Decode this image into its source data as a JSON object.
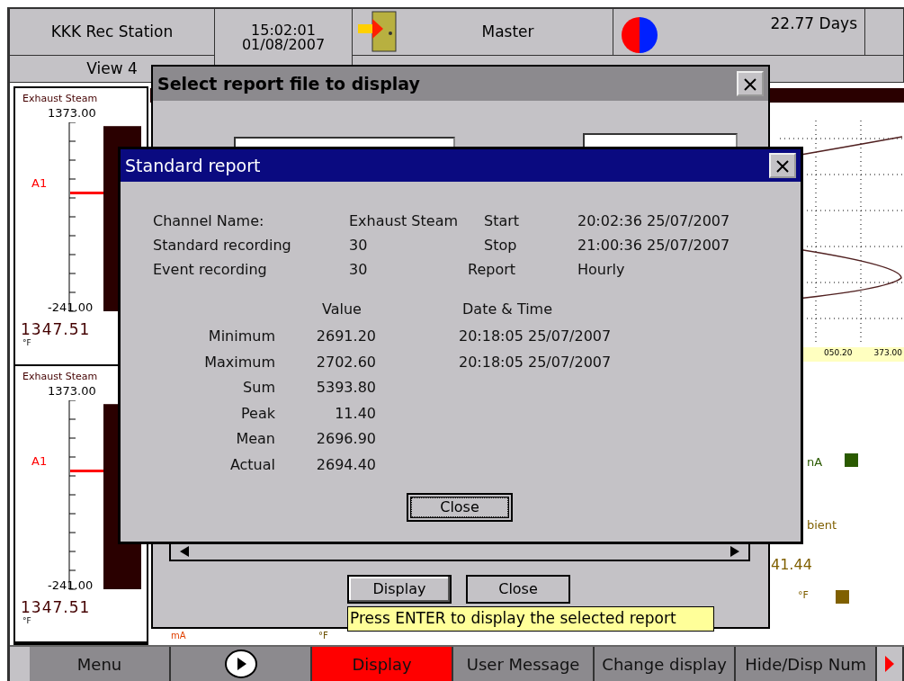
{
  "header": {
    "station": "KKK Rec Station",
    "view": "View 4",
    "time": "15:02:01",
    "date": "01/08/2007",
    "user": "Master",
    "uptime": "22.77 Days"
  },
  "strips": [
    {
      "title": "Exhaust Steam",
      "max": "1373.00",
      "min": "-241.00",
      "alarm": "A1",
      "value": "1347.51",
      "unit": "°F",
      "level": 0.98
    },
    {
      "title": "Exhaust Steam",
      "max": "1373.00",
      "min": "-241.00",
      "alarm": "A1",
      "value": "1347.51",
      "unit": "°F",
      "level": 0.98
    }
  ],
  "chart": {
    "axis_labels": [
      "050.20",
      "373.00"
    ]
  },
  "right_panels": [
    {
      "text": "nA"
    },
    {
      "text": "bient"
    },
    {
      "text": "41.44"
    },
    {
      "text": "°F"
    }
  ],
  "bottom_units": [
    "mA",
    "°F"
  ],
  "select_dialog": {
    "title": "Select report file to display",
    "buttons": [
      {
        "label": "Display",
        "selected": true
      },
      {
        "label": "Close",
        "selected": false
      }
    ],
    "tooltip": "Press ENTER to display the selected report"
  },
  "report_dialog": {
    "title": "Standard report",
    "info": [
      [
        "Channel Name:",
        "Exhaust Steam",
        "Start",
        "20:02:36 25/07/2007"
      ],
      [
        "Standard recording",
        "30",
        "Stop",
        "21:00:36 25/07/2007"
      ],
      [
        "Event recording",
        "30",
        "Report",
        "Hourly"
      ]
    ],
    "stats_columns": [
      "Value",
      "Date & Time"
    ],
    "stats": [
      [
        "Minimum",
        "2691.20",
        "20:18:05 25/07/2007"
      ],
      [
        "Maximum",
        "2702.60",
        "20:18:05 25/07/2007"
      ],
      [
        "Sum",
        "5393.80"
      ],
      [
        "Peak",
        "11.40"
      ],
      [
        "Mean",
        "2696.90"
      ],
      [
        "Actual",
        "2694.40"
      ]
    ],
    "close": "Close"
  },
  "toolbar": [
    {
      "kind": "text",
      "label": "Menu",
      "selected": false
    },
    {
      "kind": "play",
      "selected": false
    },
    {
      "kind": "text",
      "label": "Display",
      "selected": true
    },
    {
      "kind": "text",
      "label": "User Message",
      "selected": false
    },
    {
      "kind": "text",
      "label": "Change display",
      "selected": false
    },
    {
      "kind": "text",
      "label": "Hide/Disp Num",
      "selected": false
    },
    {
      "kind": "more",
      "selected": false
    }
  ]
}
